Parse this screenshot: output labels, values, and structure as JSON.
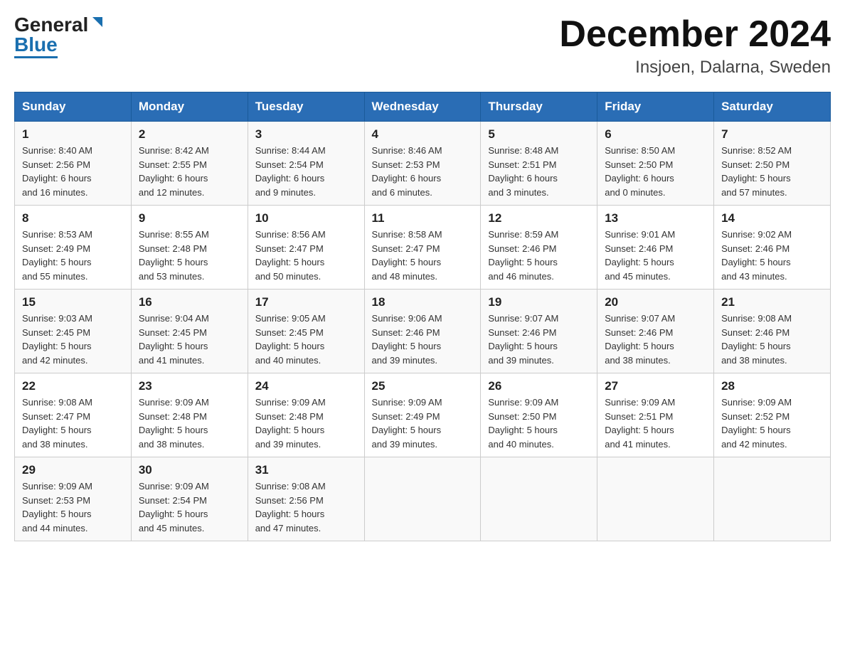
{
  "logo": {
    "general": "General",
    "blue": "Blue"
  },
  "title": "December 2024",
  "subtitle": "Insjoen, Dalarna, Sweden",
  "days_of_week": [
    "Sunday",
    "Monday",
    "Tuesday",
    "Wednesday",
    "Thursday",
    "Friday",
    "Saturday"
  ],
  "weeks": [
    [
      {
        "num": "1",
        "info": "Sunrise: 8:40 AM\nSunset: 2:56 PM\nDaylight: 6 hours\nand 16 minutes."
      },
      {
        "num": "2",
        "info": "Sunrise: 8:42 AM\nSunset: 2:55 PM\nDaylight: 6 hours\nand 12 minutes."
      },
      {
        "num": "3",
        "info": "Sunrise: 8:44 AM\nSunset: 2:54 PM\nDaylight: 6 hours\nand 9 minutes."
      },
      {
        "num": "4",
        "info": "Sunrise: 8:46 AM\nSunset: 2:53 PM\nDaylight: 6 hours\nand 6 minutes."
      },
      {
        "num": "5",
        "info": "Sunrise: 8:48 AM\nSunset: 2:51 PM\nDaylight: 6 hours\nand 3 minutes."
      },
      {
        "num": "6",
        "info": "Sunrise: 8:50 AM\nSunset: 2:50 PM\nDaylight: 6 hours\nand 0 minutes."
      },
      {
        "num": "7",
        "info": "Sunrise: 8:52 AM\nSunset: 2:50 PM\nDaylight: 5 hours\nand 57 minutes."
      }
    ],
    [
      {
        "num": "8",
        "info": "Sunrise: 8:53 AM\nSunset: 2:49 PM\nDaylight: 5 hours\nand 55 minutes."
      },
      {
        "num": "9",
        "info": "Sunrise: 8:55 AM\nSunset: 2:48 PM\nDaylight: 5 hours\nand 53 minutes."
      },
      {
        "num": "10",
        "info": "Sunrise: 8:56 AM\nSunset: 2:47 PM\nDaylight: 5 hours\nand 50 minutes."
      },
      {
        "num": "11",
        "info": "Sunrise: 8:58 AM\nSunset: 2:47 PM\nDaylight: 5 hours\nand 48 minutes."
      },
      {
        "num": "12",
        "info": "Sunrise: 8:59 AM\nSunset: 2:46 PM\nDaylight: 5 hours\nand 46 minutes."
      },
      {
        "num": "13",
        "info": "Sunrise: 9:01 AM\nSunset: 2:46 PM\nDaylight: 5 hours\nand 45 minutes."
      },
      {
        "num": "14",
        "info": "Sunrise: 9:02 AM\nSunset: 2:46 PM\nDaylight: 5 hours\nand 43 minutes."
      }
    ],
    [
      {
        "num": "15",
        "info": "Sunrise: 9:03 AM\nSunset: 2:45 PM\nDaylight: 5 hours\nand 42 minutes."
      },
      {
        "num": "16",
        "info": "Sunrise: 9:04 AM\nSunset: 2:45 PM\nDaylight: 5 hours\nand 41 minutes."
      },
      {
        "num": "17",
        "info": "Sunrise: 9:05 AM\nSunset: 2:45 PM\nDaylight: 5 hours\nand 40 minutes."
      },
      {
        "num": "18",
        "info": "Sunrise: 9:06 AM\nSunset: 2:46 PM\nDaylight: 5 hours\nand 39 minutes."
      },
      {
        "num": "19",
        "info": "Sunrise: 9:07 AM\nSunset: 2:46 PM\nDaylight: 5 hours\nand 39 minutes."
      },
      {
        "num": "20",
        "info": "Sunrise: 9:07 AM\nSunset: 2:46 PM\nDaylight: 5 hours\nand 38 minutes."
      },
      {
        "num": "21",
        "info": "Sunrise: 9:08 AM\nSunset: 2:46 PM\nDaylight: 5 hours\nand 38 minutes."
      }
    ],
    [
      {
        "num": "22",
        "info": "Sunrise: 9:08 AM\nSunset: 2:47 PM\nDaylight: 5 hours\nand 38 minutes."
      },
      {
        "num": "23",
        "info": "Sunrise: 9:09 AM\nSunset: 2:48 PM\nDaylight: 5 hours\nand 38 minutes."
      },
      {
        "num": "24",
        "info": "Sunrise: 9:09 AM\nSunset: 2:48 PM\nDaylight: 5 hours\nand 39 minutes."
      },
      {
        "num": "25",
        "info": "Sunrise: 9:09 AM\nSunset: 2:49 PM\nDaylight: 5 hours\nand 39 minutes."
      },
      {
        "num": "26",
        "info": "Sunrise: 9:09 AM\nSunset: 2:50 PM\nDaylight: 5 hours\nand 40 minutes."
      },
      {
        "num": "27",
        "info": "Sunrise: 9:09 AM\nSunset: 2:51 PM\nDaylight: 5 hours\nand 41 minutes."
      },
      {
        "num": "28",
        "info": "Sunrise: 9:09 AM\nSunset: 2:52 PM\nDaylight: 5 hours\nand 42 minutes."
      }
    ],
    [
      {
        "num": "29",
        "info": "Sunrise: 9:09 AM\nSunset: 2:53 PM\nDaylight: 5 hours\nand 44 minutes."
      },
      {
        "num": "30",
        "info": "Sunrise: 9:09 AM\nSunset: 2:54 PM\nDaylight: 5 hours\nand 45 minutes."
      },
      {
        "num": "31",
        "info": "Sunrise: 9:08 AM\nSunset: 2:56 PM\nDaylight: 5 hours\nand 47 minutes."
      },
      null,
      null,
      null,
      null
    ]
  ]
}
